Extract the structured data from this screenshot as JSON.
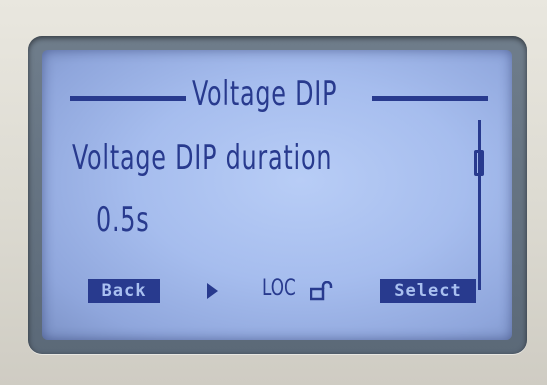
{
  "screen": {
    "title": "Voltage DIP",
    "parameter_label": "Voltage DIP duration",
    "parameter_value": "0.5s"
  },
  "softkeys": {
    "left_label": "Back",
    "right_label": "Select"
  },
  "status": {
    "lock_label": "LOC",
    "lock_icon": "unlocked-padlock-icon",
    "nav_icon": "play-arrow-icon"
  },
  "colors": {
    "lcd_background": "#a6bdee",
    "lcd_foreground": "#283a8e",
    "housing": "#dedcd3"
  }
}
